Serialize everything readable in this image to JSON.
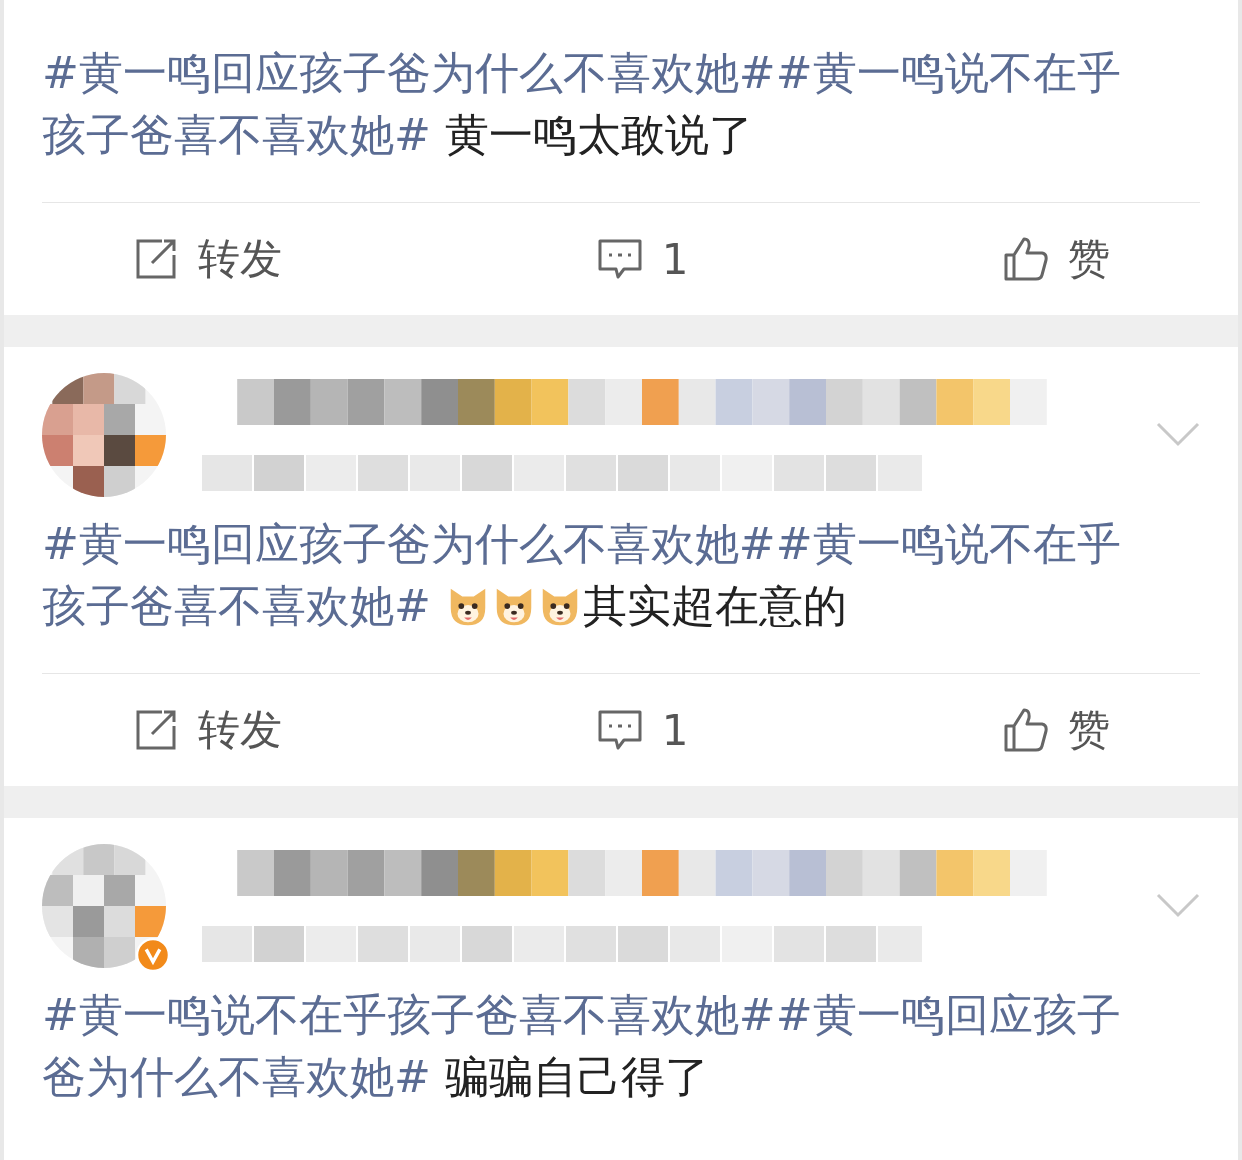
{
  "posts": [
    {
      "segments": [
        {
          "kind": "hashtag",
          "text": "#黄一鸣回应孩子爸为什么不喜欢她#"
        },
        {
          "kind": "hashtag",
          "text": "#黄一鸣说不在乎孩子爸喜不喜欢她#"
        },
        {
          "kind": "text",
          "text": " 黄一鸣太敢说了"
        }
      ],
      "actions": {
        "repost": "转发",
        "comments": "1",
        "like": "赞"
      }
    },
    {
      "header": {
        "verified": false
      },
      "segments": [
        {
          "kind": "hashtag",
          "text": "#黄一鸣回应孩子爸为什么不喜欢她#"
        },
        {
          "kind": "hashtag",
          "text": "#黄一鸣说不在乎孩子爸喜不喜欢她#"
        },
        {
          "kind": "emoji"
        },
        {
          "kind": "emoji"
        },
        {
          "kind": "emoji"
        },
        {
          "kind": "text",
          "text": "其实超在意的"
        }
      ],
      "actions": {
        "repost": "转发",
        "comments": "1",
        "like": "赞"
      }
    },
    {
      "header": {
        "verified": true
      },
      "segments": [
        {
          "kind": "hashtag",
          "text": "#黄一鸣说不在乎孩子爸喜不喜欢她#"
        },
        {
          "kind": "hashtag",
          "text": "#黄一鸣回应孩子爸为什么不喜欢她#"
        },
        {
          "kind": "text",
          "text": " 骗骗自己得了"
        }
      ]
    }
  ]
}
